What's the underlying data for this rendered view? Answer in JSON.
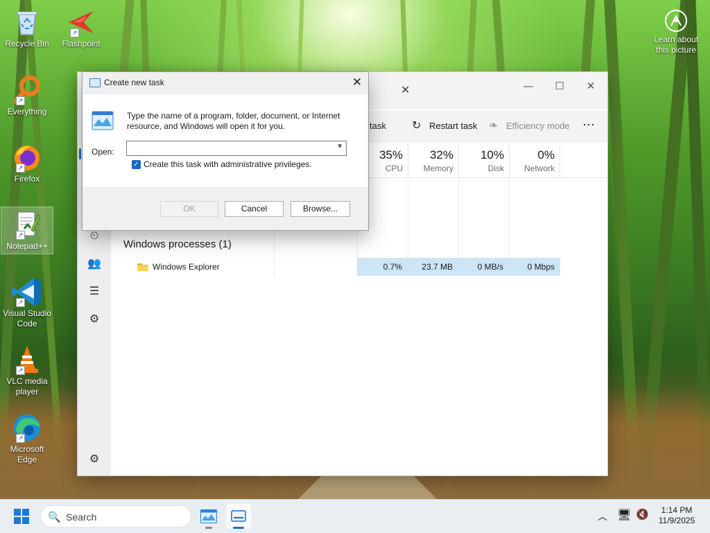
{
  "desktop": {
    "icons": [
      {
        "label": "Recycle Bin",
        "icon": "recycle-bin-icon",
        "shortcut": false
      },
      {
        "label": "Flashpoint",
        "icon": "flashpoint-icon",
        "shortcut": true
      },
      {
        "label": "Everything",
        "icon": "everything-icon",
        "shortcut": true
      },
      {
        "label": "Firefox",
        "icon": "firefox-icon",
        "shortcut": true
      },
      {
        "label": "Notepad++",
        "icon": "notepad-plus-plus-icon",
        "shortcut": true
      },
      {
        "label": "Visual Studio Code",
        "icon": "vscode-icon",
        "shortcut": true
      },
      {
        "label": "VLC media player",
        "icon": "vlc-icon",
        "shortcut": true
      },
      {
        "label": "Microsoft Edge",
        "icon": "edge-icon",
        "shortcut": true
      }
    ],
    "learn_about": {
      "label": "Learn about this picture",
      "icon": "camera-icon"
    }
  },
  "task_manager": {
    "toolbar": {
      "run_new_task": "w task",
      "restart_task": "Restart task",
      "efficiency_mode": "Efficiency mode",
      "more": "⋯"
    },
    "columns": [
      {
        "pct": "35%",
        "label": "CPU"
      },
      {
        "pct": "32%",
        "label": "Memory"
      },
      {
        "pct": "10%",
        "label": "Disk"
      },
      {
        "pct": "0%",
        "label": "Network"
      }
    ],
    "group_title": "Windows processes (1)",
    "processes": [
      {
        "name": "Windows Explorer",
        "cpu": "0.7%",
        "memory": "23.7 MB",
        "disk": "0 MB/s",
        "network": "0 Mbps"
      }
    ]
  },
  "run_dialog": {
    "title": "Create new task",
    "description": "Type the name of a program, folder, document, or Internet resource, and Windows will open it for you.",
    "open_label": "Open:",
    "open_value": "",
    "admin_checkbox_label": "Create this task with administrative privileges.",
    "admin_checked": true,
    "ok": "OK",
    "cancel": "Cancel",
    "browse": "Browse..."
  },
  "taskbar": {
    "search_placeholder": "Search",
    "time": "1:14 PM",
    "date": "11/9/2025"
  },
  "colors": {
    "accent": "#1b6fc9",
    "highlight_row": "#cce6f7",
    "taskbar": "#e9eef3"
  }
}
